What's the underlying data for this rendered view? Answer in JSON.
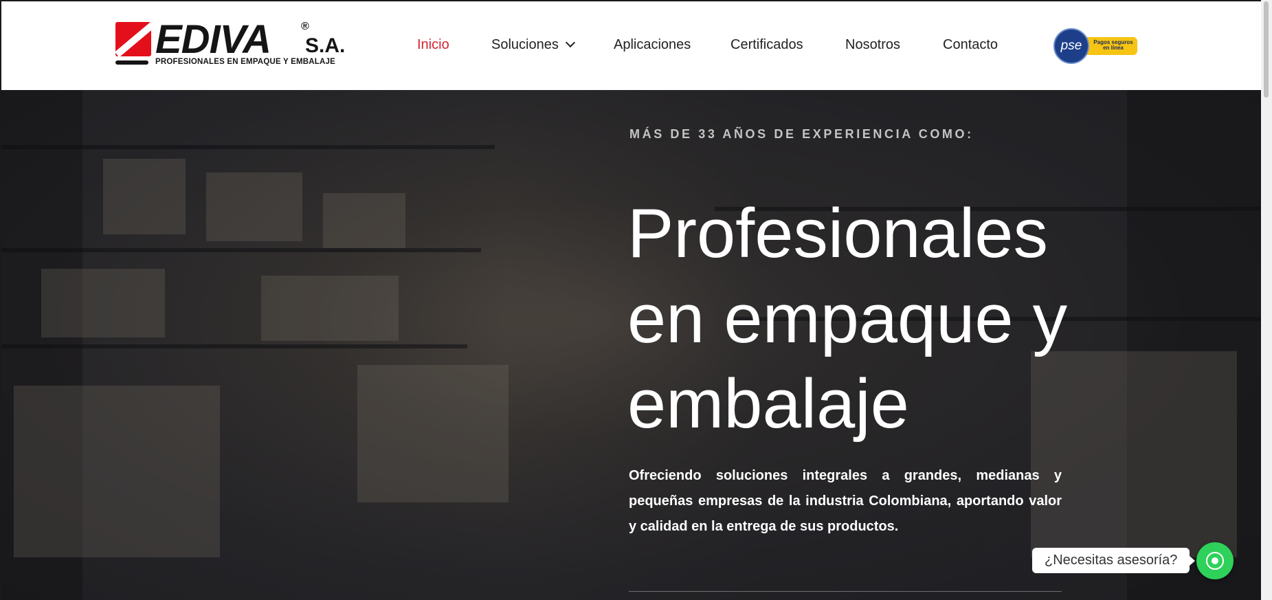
{
  "brand": {
    "name": "EDIVA",
    "registered": "®",
    "suffix": "S.A.",
    "tagline": "PROFESIONALES EN EMPAQUE Y EMBALAJE"
  },
  "nav": {
    "items": [
      {
        "label": "Inicio",
        "active": true
      },
      {
        "label": "Soluciones",
        "has_dropdown": true
      },
      {
        "label": "Aplicaciones"
      },
      {
        "label": "Certificados"
      },
      {
        "label": "Nosotros"
      },
      {
        "label": "Contacto"
      }
    ]
  },
  "pse": {
    "logo_text": "pse",
    "band_text": "Pagos seguros en línea"
  },
  "hero": {
    "kicker": "MÁS DE 33 AÑOS DE EXPERIENCIA COMO:",
    "headline": "Profesionales en empaque y embalaje",
    "lede": "Ofreciendo soluciones integrales a grandes, medianas y pequeñas empresas de la industria Colombiana, aportando valor y calidad en la entrega de sus productos."
  },
  "chat": {
    "label": "¿Necesitas asesoría?"
  },
  "colors": {
    "accent": "#d0262e",
    "whatsapp": "#2ed15a",
    "hero_bg": "#272629"
  }
}
